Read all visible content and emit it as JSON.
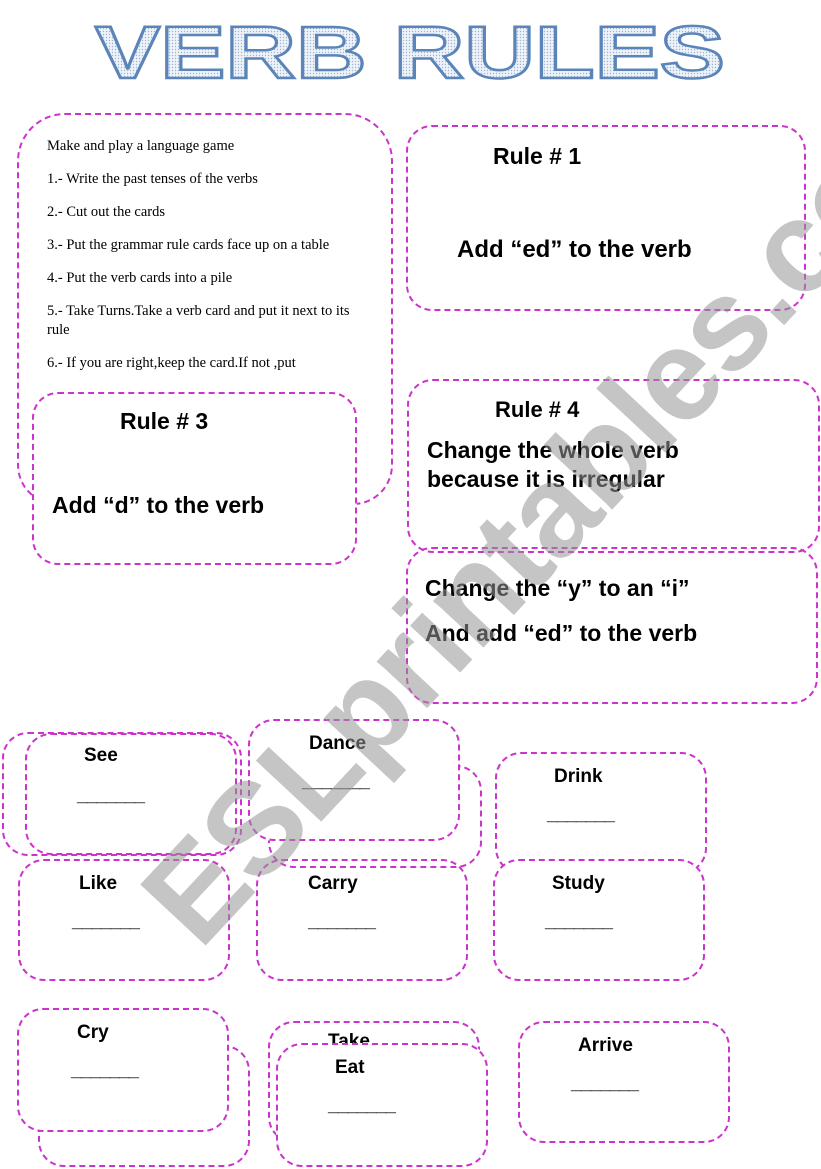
{
  "title": "VERB RULES",
  "instructions": {
    "heading": "Make and play a language game",
    "steps": [
      "1.- Write the past tenses of the verbs",
      "2.- Cut out the cards",
      "3.- Put the grammar rule cards face up on a table",
      "4.- Put the verb cards into a pile",
      "5.- Take Turns.Take a verb card and put it next to its rule",
      "6.- If you are right,keep the card.If not ,put"
    ]
  },
  "rules": {
    "rule1": {
      "title": "Rule # 1",
      "text": "Add “ed” to the verb"
    },
    "rule3": {
      "title": "Rule # 3",
      "text": "Add “d” to the verb"
    },
    "rule4": {
      "title": "Rule # 4",
      "text_line1": "Change the whole verb",
      "text_line2": "because it is irregular"
    },
    "rule2": {
      "text_line1": "Change the “y” to an “i”",
      "text_line2": "And add “ed” to the verb"
    }
  },
  "verbs": {
    "see": "See",
    "dance": "Dance",
    "drink": "Drink",
    "like": "Like",
    "carry": "Carry",
    "study": "Study",
    "cry": "Cry",
    "take": "Take",
    "eat": "Eat",
    "arrive": "Arrive"
  },
  "blank": "_______",
  "watermark": "ESLprintables.com",
  "colors": {
    "border": "#cc33cc",
    "title_fill": "#dfe9f5",
    "title_stroke": "#5b85b8",
    "watermark": "#969696"
  }
}
